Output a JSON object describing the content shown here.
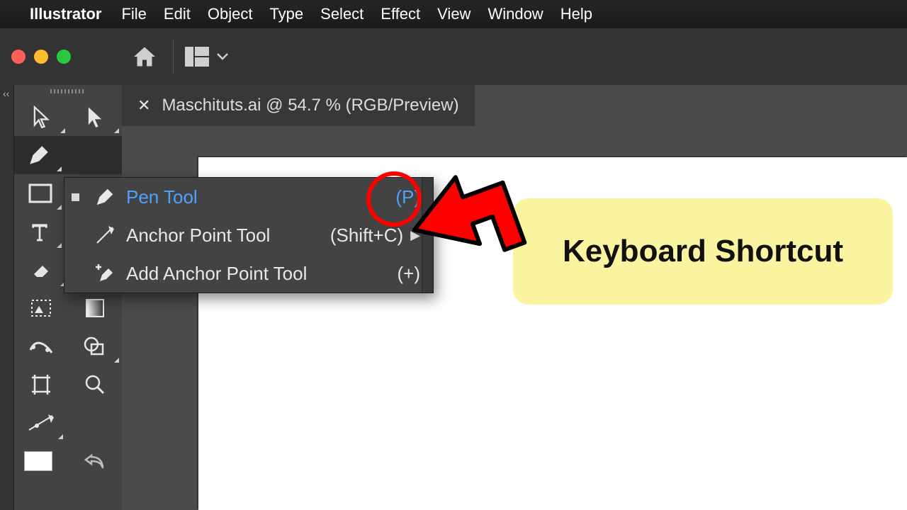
{
  "menubar": {
    "appname": "Illustrator",
    "items": [
      "File",
      "Edit",
      "Object",
      "Type",
      "Select",
      "Effect",
      "View",
      "Window",
      "Help"
    ]
  },
  "doctab": {
    "title": "Maschituts.ai @ 54.7 % (RGB/Preview)"
  },
  "flyout": {
    "rows": [
      {
        "label": "Pen Tool",
        "shortcut": "(P)",
        "selected": true,
        "hasSub": false
      },
      {
        "label": "Anchor Point Tool",
        "shortcut": "(Shift+C)",
        "selected": false,
        "hasSub": true
      },
      {
        "label": "Add Anchor Point Tool",
        "shortcut": "(+)",
        "selected": false,
        "hasSub": false
      }
    ]
  },
  "callout": {
    "text": "Keyboard Shortcut"
  }
}
